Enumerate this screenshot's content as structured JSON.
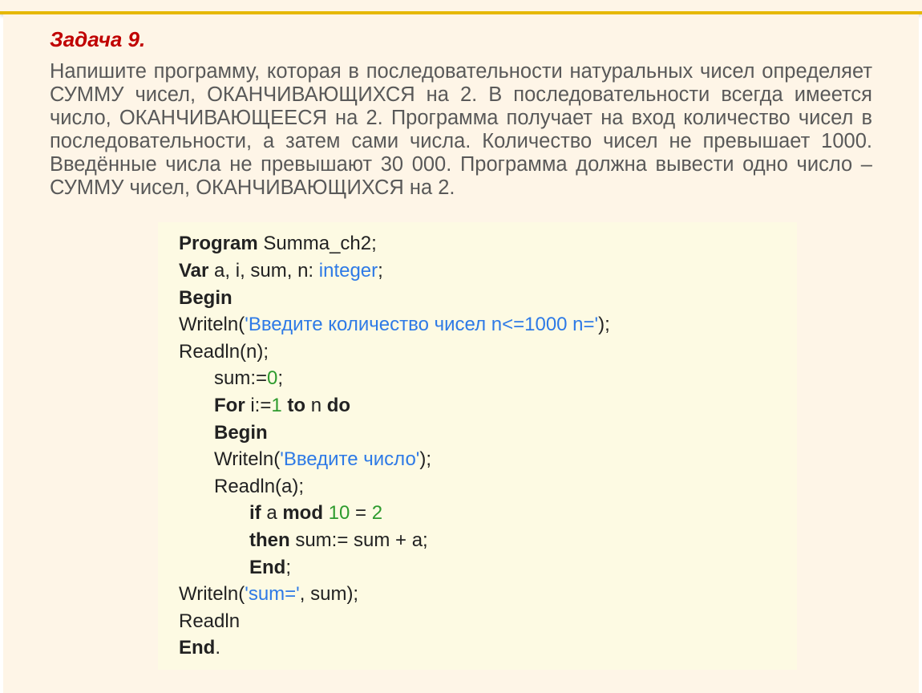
{
  "task_title": "Задача 9.",
  "task_text": "Напишите программу, которая в последовательности натуральных чисел определяет СУММУ чисел, ОКАНЧИВАЮЩИХСЯ на 2. В последовательности всегда имеется число, ОКАНЧИВАЮЩЕЕСЯ на 2. Программа получает на вход количество чисел в последовательности, а затем сами числа. Количество чисел не превышает 1000. Введённые числа не превышают 30 000. Программа должна вывести одно число – СУММУ чисел, ОКАНЧИВАЮЩИХСЯ на 2.",
  "code": {
    "kw_program": "Program ",
    "progname": "Summa_ch2;",
    "kw_var": "Var ",
    "vars": "a, i, sum, n: ",
    "type": "integer",
    "semi": ";",
    "kw_begin": "Begin",
    "writeln1a": "Writeln(",
    "str1": "'Введите количество чисел n<=1000 n='",
    "writeln1b": ");",
    "readln_n": "Readln(n);",
    "sum0a": "sum:=",
    "zero": "0",
    "sum0b": ";",
    "for_a": "For ",
    "for_b": "i:=",
    "one": "1",
    "for_c": " to ",
    "for_d": "n ",
    "for_do": "do",
    "begin2": "Begin",
    "writeln2a": "Writeln(",
    "str2": "'Введите число'",
    "writeln2b": ");",
    "readln_a": "Readln(a);",
    "if_a": "if ",
    "if_b": "a ",
    "mod": "mod ",
    "ten": "10",
    "if_c": " = ",
    "two": "2",
    "then_a": "then ",
    "then_b": "sum:= sum + a;",
    "end1": "End",
    "end1s": ";",
    "writeln3a": "Writeln(",
    "str3": "'sum='",
    "writeln3b": ", sum);",
    "readln_e": "Readln",
    "end_final": "End",
    "end_final_dot": "."
  }
}
